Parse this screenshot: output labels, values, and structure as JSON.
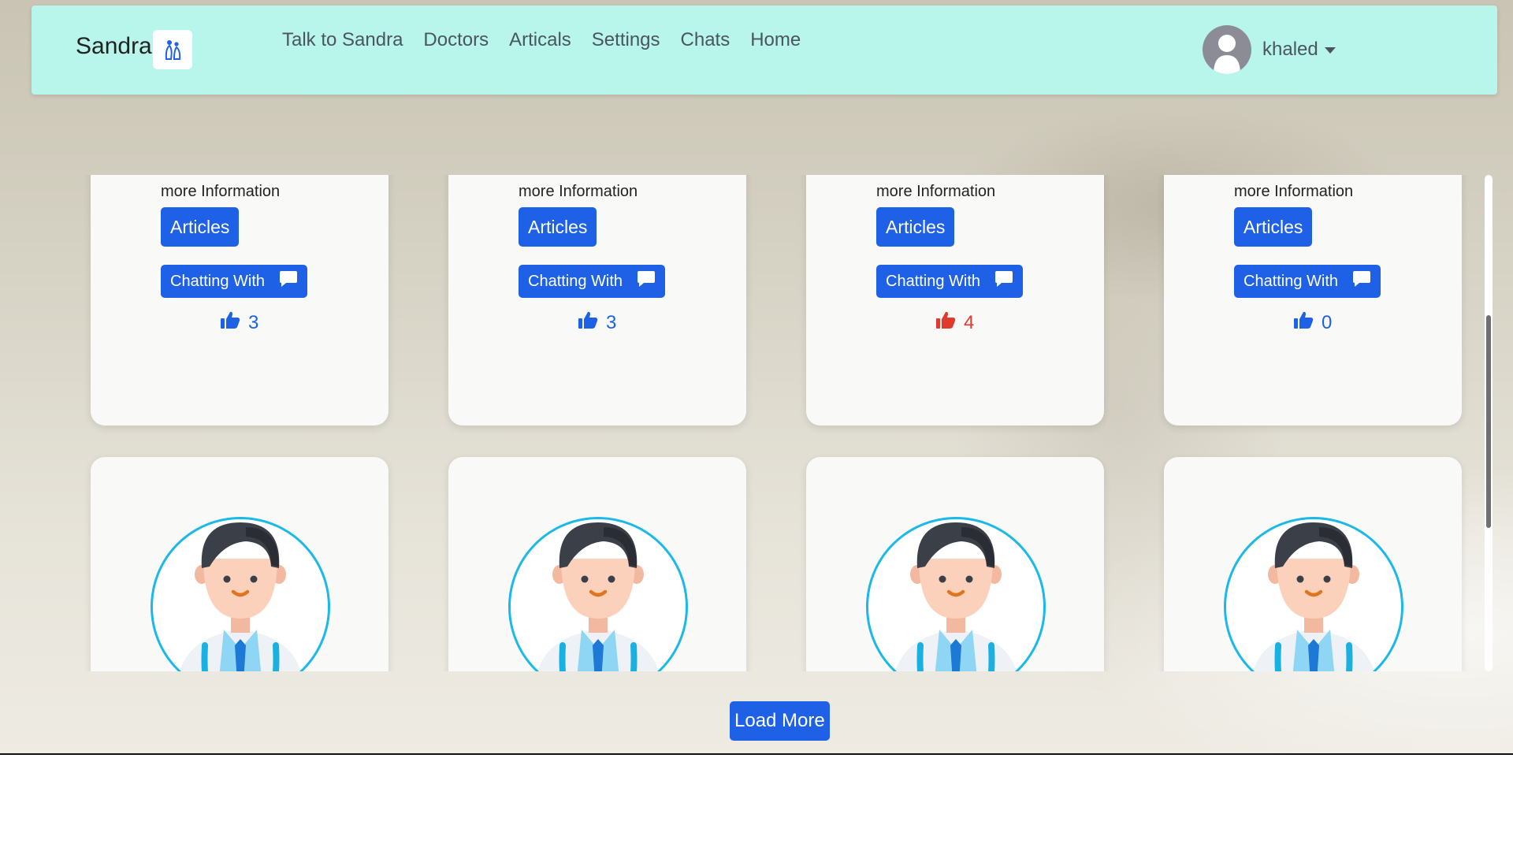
{
  "navbar": {
    "brand": "Sandra",
    "links": [
      "Talk to Sandra",
      "Doctors",
      "Articals",
      "Settings",
      "Chats",
      "Home"
    ],
    "user": {
      "name": "khaled"
    }
  },
  "cards": [
    {
      "more_info": "more Information",
      "articles_label": "Articles",
      "chat_label": "Chatting With",
      "likes": "3",
      "liked": false
    },
    {
      "more_info": "more Information",
      "articles_label": "Articles",
      "chat_label": "Chatting With",
      "likes": "3",
      "liked": false
    },
    {
      "more_info": "more Information",
      "articles_label": "Articles",
      "chat_label": "Chatting With",
      "likes": "4",
      "liked": true
    },
    {
      "more_info": "more Information",
      "articles_label": "Articles",
      "chat_label": "Chatting With",
      "likes": "0",
      "liked": false
    }
  ],
  "colors": {
    "accent": "#1e61e6",
    "liked": "#e03a2f",
    "navbar": "#b8f5ea",
    "avatar_ring": "#1ab9e8"
  },
  "load_more": "Load More"
}
